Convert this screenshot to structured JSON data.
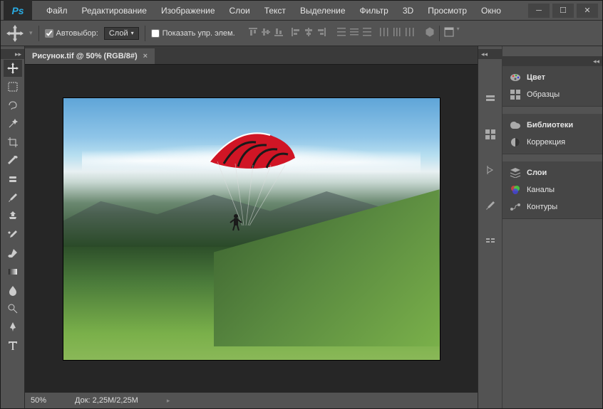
{
  "app": {
    "logo_text": "Ps"
  },
  "menubar": [
    "Файл",
    "Редактирование",
    "Изображение",
    "Слои",
    "Текст",
    "Выделение",
    "Фильтр",
    "3D",
    "Просмотр",
    "Окно"
  ],
  "options": {
    "auto_select_label": "Автовыбор:",
    "auto_select_checked": true,
    "select_scope": "Слой",
    "show_transform_label": "Показать упр. элем.",
    "show_transform_checked": false
  },
  "document": {
    "tab_title": "Рисунок.tif @ 50% (RGB/8#)",
    "zoom": "50%",
    "doc_size": "Док: 2,25М/2,25М"
  },
  "panels": {
    "group1": [
      {
        "icon": "color-icon",
        "label": "Цвет",
        "active": true
      },
      {
        "icon": "swatches-icon",
        "label": "Образцы",
        "active": false
      }
    ],
    "group2": [
      {
        "icon": "libraries-icon",
        "label": "Библиотеки",
        "active": true
      },
      {
        "icon": "adjustments-icon",
        "label": "Коррекция",
        "active": false
      }
    ],
    "group3": [
      {
        "icon": "layers-icon",
        "label": "Слои",
        "active": true
      },
      {
        "icon": "channels-icon",
        "label": "Каналы",
        "active": false
      },
      {
        "icon": "paths-icon",
        "label": "Контуры",
        "active": false
      }
    ]
  },
  "tools": [
    "move-tool",
    "marquee-tool",
    "lasso-tool",
    "magic-wand-tool",
    "crop-tool",
    "eyedropper-tool",
    "healing-brush-tool",
    "brush-tool",
    "clone-stamp-tool",
    "history-brush-tool",
    "eraser-tool",
    "gradient-tool",
    "blur-tool",
    "dodge-tool",
    "pen-tool",
    "type-tool"
  ],
  "icon_column": [
    "history-icon",
    "properties-icon",
    "character-icon",
    "brush-preset-icon",
    "layer-comps-icon"
  ]
}
